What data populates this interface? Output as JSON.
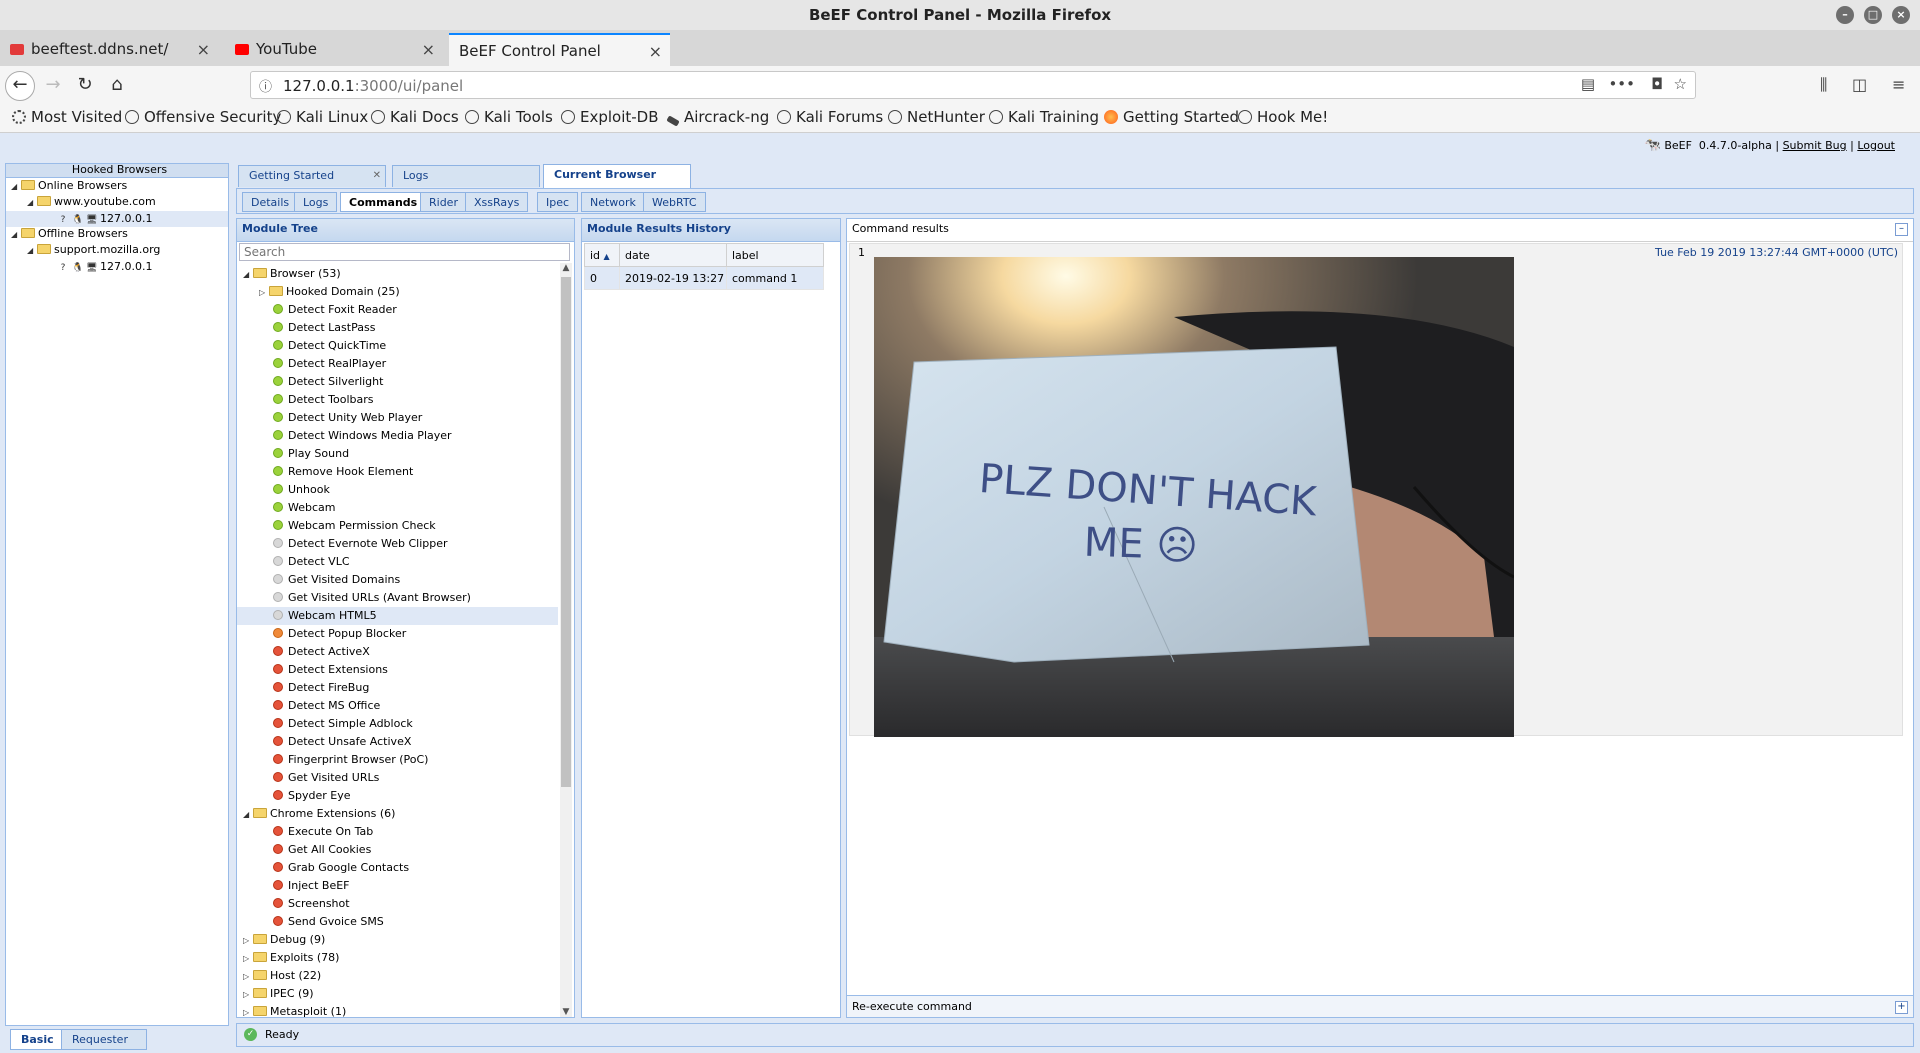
{
  "window": {
    "title": "BeEF Control Panel - Mozilla Firefox"
  },
  "browser_tabs": [
    {
      "label": "beeftest.ddns.net/"
    },
    {
      "label": "YouTube"
    },
    {
      "label": "BeEF Control Panel"
    }
  ],
  "url": {
    "host": "127.0.0.1",
    "rest": ":3000/ui/panel"
  },
  "bookmarks": [
    "Most Visited",
    "Offensive Security",
    "Kali Linux",
    "Kali Docs",
    "Kali Tools",
    "Exploit-DB",
    "Aircrack-ng",
    "Kali Forums",
    "NetHunter",
    "Kali Training",
    "Getting Started",
    "Hook Me!"
  ],
  "beef": {
    "name": "BeEF",
    "version": "0.4.7.0-alpha",
    "submit_bug": "Submit  Bug",
    "logout": "Logout",
    "sep": "|"
  },
  "hooked": {
    "title": "Hooked Browsers",
    "online": "Online Browsers",
    "online_domain": "www.youtube.com",
    "online_ip": "127.0.0.1",
    "offline": "Offline Browsers",
    "offline_domain": "support.mozilla.org",
    "offline_ip": "127.0.0.1"
  },
  "left_tabs": [
    "Basic",
    "Requester"
  ],
  "main_tabs": [
    "Getting Started",
    "Logs",
    "Current Browser"
  ],
  "sub_tabs": [
    "Details",
    "Logs",
    "Commands",
    "Rider",
    "XssRays",
    "Ipec",
    "Network",
    "WebRTC"
  ],
  "module_tree": {
    "title": "Module Tree",
    "search_placeholder": "Search",
    "items": [
      {
        "label": "Browser (53)",
        "kind": "folder",
        "level": 0,
        "open": true
      },
      {
        "label": "Hooked Domain (25)",
        "kind": "folder",
        "level": 1,
        "open": false
      },
      {
        "label": "Detect Foxit Reader",
        "kind": "green",
        "level": 1
      },
      {
        "label": "Detect LastPass",
        "kind": "green",
        "level": 1
      },
      {
        "label": "Detect QuickTime",
        "kind": "green",
        "level": 1
      },
      {
        "label": "Detect RealPlayer",
        "kind": "green",
        "level": 1
      },
      {
        "label": "Detect Silverlight",
        "kind": "green",
        "level": 1
      },
      {
        "label": "Detect Toolbars",
        "kind": "green",
        "level": 1
      },
      {
        "label": "Detect Unity Web Player",
        "kind": "green",
        "level": 1
      },
      {
        "label": "Detect Windows Media Player",
        "kind": "green",
        "level": 1
      },
      {
        "label": "Play Sound",
        "kind": "green",
        "level": 1
      },
      {
        "label": "Remove Hook Element",
        "kind": "green",
        "level": 1
      },
      {
        "label": "Unhook",
        "kind": "green",
        "level": 1
      },
      {
        "label": "Webcam",
        "kind": "green",
        "level": 1
      },
      {
        "label": "Webcam Permission Check",
        "kind": "green",
        "level": 1
      },
      {
        "label": "Detect Evernote Web Clipper",
        "kind": "grey",
        "level": 1
      },
      {
        "label": "Detect VLC",
        "kind": "grey",
        "level": 1
      },
      {
        "label": "Get Visited Domains",
        "kind": "grey",
        "level": 1
      },
      {
        "label": "Get Visited URLs (Avant Browser)",
        "kind": "grey",
        "level": 1
      },
      {
        "label": "Webcam HTML5",
        "kind": "grey",
        "level": 1,
        "selected": true
      },
      {
        "label": "Detect Popup Blocker",
        "kind": "orange",
        "level": 1
      },
      {
        "label": "Detect ActiveX",
        "kind": "red",
        "level": 1
      },
      {
        "label": "Detect Extensions",
        "kind": "red",
        "level": 1
      },
      {
        "label": "Detect FireBug",
        "kind": "red",
        "level": 1
      },
      {
        "label": "Detect MS Office",
        "kind": "red",
        "level": 1
      },
      {
        "label": "Detect Simple Adblock",
        "kind": "red",
        "level": 1
      },
      {
        "label": "Detect Unsafe ActiveX",
        "kind": "red",
        "level": 1
      },
      {
        "label": "Fingerprint Browser (PoC)",
        "kind": "red",
        "level": 1
      },
      {
        "label": "Get Visited URLs",
        "kind": "red",
        "level": 1
      },
      {
        "label": "Spyder Eye",
        "kind": "red",
        "level": 1
      },
      {
        "label": "Chrome Extensions (6)",
        "kind": "folder",
        "level": 0,
        "open": true
      },
      {
        "label": "Execute On Tab",
        "kind": "red",
        "level": 1
      },
      {
        "label": "Get All Cookies",
        "kind": "red",
        "level": 1
      },
      {
        "label": "Grab Google Contacts",
        "kind": "red",
        "level": 1
      },
      {
        "label": "Inject BeEF",
        "kind": "red",
        "level": 1
      },
      {
        "label": "Screenshot",
        "kind": "red",
        "level": 1
      },
      {
        "label": "Send Gvoice SMS",
        "kind": "red",
        "level": 1
      },
      {
        "label": "Debug (9)",
        "kind": "folder",
        "level": 0,
        "open": false
      },
      {
        "label": "Exploits (78)",
        "kind": "folder",
        "level": 0,
        "open": false
      },
      {
        "label": "Host (22)",
        "kind": "folder",
        "level": 0,
        "open": false
      },
      {
        "label": "IPEC (9)",
        "kind": "folder",
        "level": 0,
        "open": false
      },
      {
        "label": "Metasploit (1)",
        "kind": "folder",
        "level": 0,
        "open": false
      }
    ]
  },
  "history": {
    "title": "Module Results History",
    "columns": [
      "id",
      "date",
      "label"
    ],
    "rows": [
      [
        "0",
        "2019-02-19 13:27",
        "command 1"
      ]
    ]
  },
  "results": {
    "title": "Command results",
    "row_number": "1",
    "timestamp": "Tue Feb 19 2019 13:27:44 GMT+0000 (UTC)",
    "note_line1": "PLZ DON'T HACK",
    "note_line2": "ME ☹",
    "reexecute": "Re-execute command"
  },
  "status": {
    "text": "Ready"
  },
  "colors": {
    "accent": "#15428b",
    "panel_border": "#99bbe8"
  }
}
